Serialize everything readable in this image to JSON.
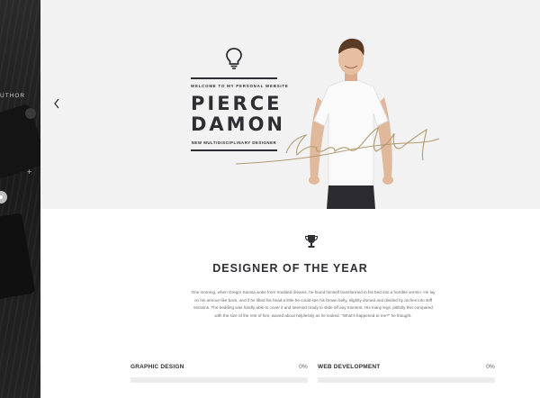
{
  "sidebar": {
    "label": "UTHOR",
    "plus": "+"
  },
  "hero": {
    "welcome": "WELCOME TO MY PERSONAL WEBSITE",
    "first_name": "PIERCE",
    "last_name": "DAMON",
    "tagline": "NEW MULTIDISCIPLINARY DESIGNER",
    "prev_icon": "chevron-left-icon",
    "top_icon": "lightbulb-icon"
  },
  "section": {
    "icon": "trophy-icon",
    "title": "DESIGNER OF THE YEAR",
    "paragraph": "One morning, when Gregor Samsa woke from troubled dreams, he found himself transformed in his bed into a horrible vermin. He lay on his armour-like back, and if he lifted his head a little he could see his brown belly, slightly domed and divided by arches into stiff sections. The bedding was hardly able to cover it and seemed ready to slide off any moment. His many legs, pitifully thin compared with the size of the rest of him, waved about helplessly as he looked. \"What's happened to me?\" he thought."
  },
  "skills": [
    {
      "label": "GRAPHIC DESIGN",
      "percent": "0%",
      "value": 0
    },
    {
      "label": "WEB DEVELOPMENT",
      "percent": "0%",
      "value": 0
    }
  ],
  "colors": {
    "dark": "#2f2f33",
    "hero_bg": "#f2f2f2",
    "signature": "#b39b6f"
  }
}
